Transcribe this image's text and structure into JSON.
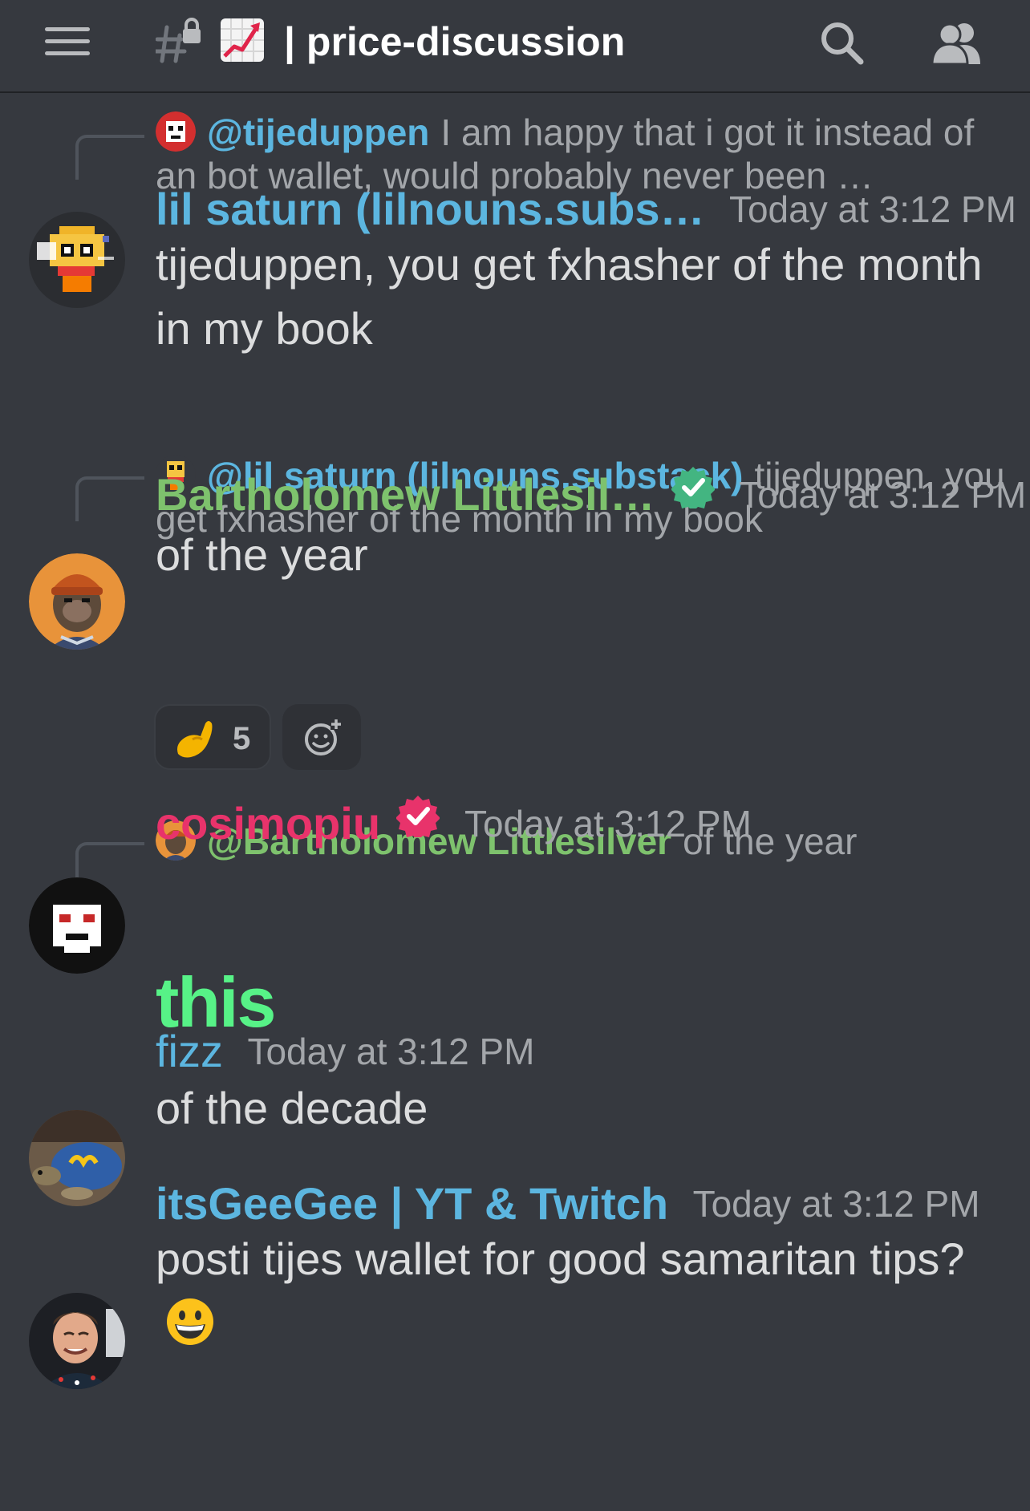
{
  "header": {
    "channel_name": "price-discussion",
    "channel_prefix_separator": "|"
  },
  "messages": [
    {
      "reply": {
        "mention": "@tijeduppen",
        "text": "I am happy that i got it instead of an bot wallet, would probably never been …",
        "mention_color": "#5cb6e0"
      },
      "author": "lil saturn (lilnouns.subs…",
      "author_color": "#5cb6e0",
      "timestamp": "Today at 3:12 PM",
      "content": "tijeduppen, you get fxhasher of the month in my book"
    },
    {
      "reply": {
        "mention": "@lil saturn (lilnouns.substack)",
        "text": "tijeduppen, you get fxhasher of the month in my book",
        "mention_color": "#5cb6e0"
      },
      "author": "Bartholomew Littlesil…",
      "author_color": "#7ec26d",
      "verified_color": "#43b581",
      "timestamp": "Today at 3:12 PM",
      "content": "of the year",
      "reaction": {
        "emoji": "pinched-fingers",
        "count": "5"
      }
    },
    {
      "reply": {
        "mention": "@Bartholomew Littlesilver",
        "text": "of the year",
        "mention_color": "#7ec26d"
      },
      "author": "cosimopiu",
      "author_color": "#e8336b",
      "verified_color": "#e8336b",
      "timestamp": "Today at 3:12 PM",
      "content": "this"
    },
    {
      "author": "fizz",
      "author_color": "#5cb6e0",
      "timestamp": "Today at 3:12 PM",
      "content": "of the decade"
    },
    {
      "author": "itsGeeGee | YT & Twitch",
      "author_color": "#5cb6e0",
      "timestamp": "Today at 3:12 PM",
      "content": "posti tijes wallet for good samaritan tips?",
      "content_emoji": "grinning-face"
    }
  ]
}
